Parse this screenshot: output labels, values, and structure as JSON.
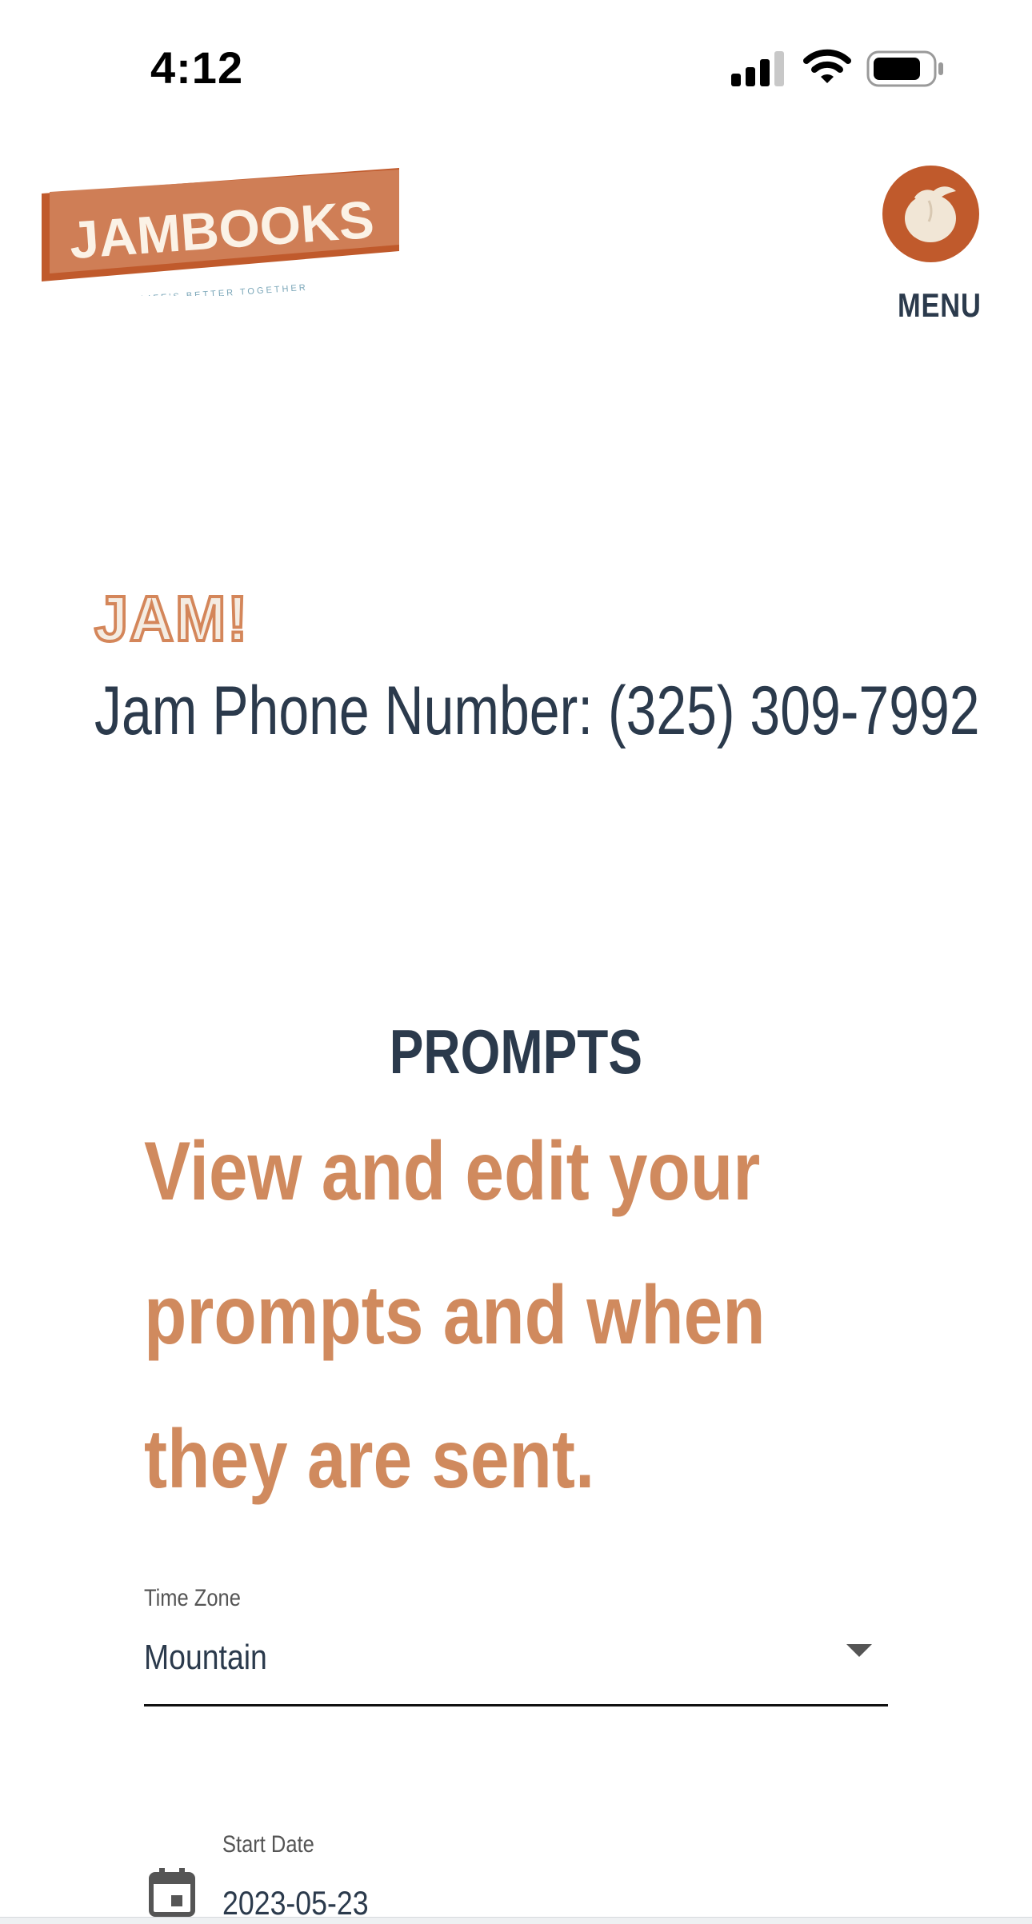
{
  "status_bar": {
    "time": "4:12"
  },
  "header": {
    "logo_text": "JAMBOOKS",
    "logo_tagline": "LIFE'S BETTER TOGETHER",
    "menu_label": "MENU",
    "menu_icon": "peach-icon",
    "brand_color": "#c05a2c"
  },
  "jam": {
    "title": "JAM!",
    "phone_line": "Jam Phone Number: (325) 309-7992"
  },
  "prompts": {
    "title": "PROMPTS",
    "subtitle": "View and edit your prompts and when they are sent."
  },
  "form": {
    "time_zone": {
      "label": "Time Zone",
      "value": "Mountain"
    },
    "start_date": {
      "label": "Start Date",
      "value": "2023-05-23"
    }
  },
  "colors": {
    "navy": "#2b3a4c",
    "accent": "#d08a5e"
  }
}
